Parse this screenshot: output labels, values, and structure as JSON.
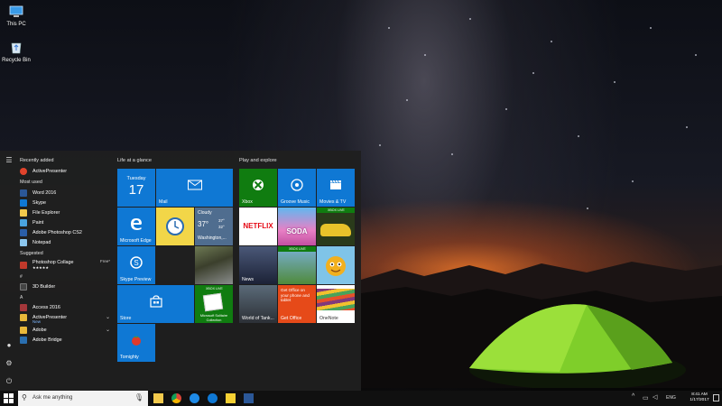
{
  "desktop": {
    "icons": [
      {
        "label": "This PC",
        "icon": "computer-icon"
      },
      {
        "label": "Recycle Bin",
        "icon": "recycle-bin-icon"
      }
    ]
  },
  "start_menu": {
    "recently_added_title": "Recently added",
    "recently_added": [
      {
        "label": "ActivePresenter",
        "icon": "activepresenter-icon"
      }
    ],
    "most_used_title": "Most used",
    "most_used": [
      {
        "label": "Word 2016",
        "icon": "word-icon"
      },
      {
        "label": "Skype",
        "icon": "skype-icon"
      },
      {
        "label": "File Explorer",
        "icon": "file-explorer-icon"
      },
      {
        "label": "Paint",
        "icon": "paint-icon"
      },
      {
        "label": "Adobe Photoshop CS2",
        "icon": "photoshop-icon"
      },
      {
        "label": "Notepad",
        "icon": "notepad-icon"
      }
    ],
    "suggested_title": "Suggested",
    "suggested": {
      "label": "Photoshop Collage",
      "price": "Free*",
      "rating": "★★★★★"
    },
    "hash_letter": "#",
    "hash_apps": [
      {
        "label": "3D Builder",
        "icon": "3d-builder-icon"
      }
    ],
    "a_letter": "A",
    "a_apps": [
      {
        "label": "Access 2016",
        "icon": "access-icon"
      },
      {
        "label": "ActivePresenter",
        "sub": "New",
        "icon": "folder-icon"
      },
      {
        "label": "Adobe",
        "icon": "folder-icon"
      },
      {
        "label": "Adobe Bridge",
        "icon": "bridge-icon"
      }
    ],
    "group_life": "Life at a glance",
    "group_play": "Play and explore",
    "tiles": {
      "calendar_day": "Tuesday",
      "calendar_date": "17",
      "mail": "Mail",
      "edge": "Microsoft Edge",
      "weather_cond": "Cloudy",
      "weather_temp1": "37°",
      "weather_temp2": "37°",
      "weather_low": "32°",
      "weather_loc": "Washington,...",
      "skype_preview": "Skype Preview",
      "store": "Store",
      "solitaire_badge": "XBOX LIVE",
      "solitaire": "Microsoft Solitaire Collection",
      "tomighty": "Tomighty",
      "xbox": "Xbox",
      "groove": "Groove Music",
      "movies": "Movies & TV",
      "netflix": "NETFLIX",
      "soda": "SODA",
      "asphalt_badge": "XBOX LIVE",
      "news": "News",
      "march_badge": "XBOX LIVE",
      "office_get": "Get Office on your phone and tablet",
      "get_office": "Get Office",
      "onenote": "OneNote",
      "wot": "World of Tank..."
    }
  },
  "taskbar": {
    "search_placeholder": "Ask me anything",
    "lang": "ENG",
    "time": "8:41 AM",
    "date": "1/17/2017"
  }
}
